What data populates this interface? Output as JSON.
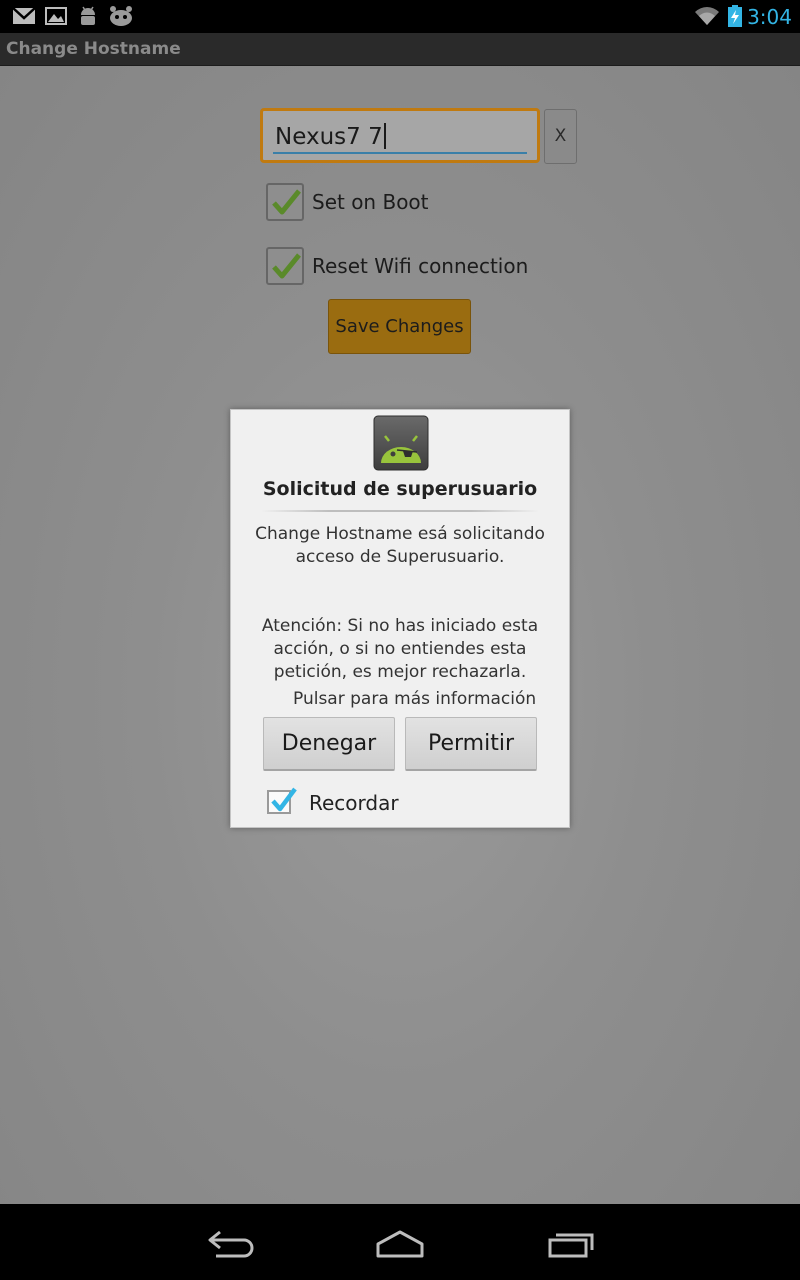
{
  "status_bar": {
    "time": "3:04",
    "time_color": "#33b5e5",
    "icons": [
      "gmail-icon",
      "gallery-icon",
      "android-debug-icon",
      "superuser-icon",
      "wifi-icon",
      "battery-charging-icon"
    ]
  },
  "app": {
    "title": "Change Hostname",
    "hostname_value": "Nexus7 7",
    "clear_label": "X",
    "set_on_boot": {
      "label": "Set on Boot",
      "checked": true
    },
    "reset_wifi": {
      "label": "Reset Wifi connection",
      "checked": true
    },
    "save_label": "Save Changes",
    "accent": "#c07a10"
  },
  "dialog": {
    "icon": "superuser-android-icon",
    "title": "Solicitud de superusuario",
    "message": "Change Hostname esá solicitando acceso de Superusuario.",
    "warning": "Atención: Si no has iniciado esta acción, o si no entiendes esta petición, es mejor rechazarla.",
    "info_link": "Pulsar para más información",
    "deny_label": "Denegar",
    "allow_label": "Permitir",
    "remember": {
      "label": "Recordar",
      "checked": true
    },
    "check_color": "#33b5e5"
  },
  "nav_bar": {
    "buttons": [
      "back-icon",
      "home-icon",
      "recent-apps-icon"
    ]
  }
}
